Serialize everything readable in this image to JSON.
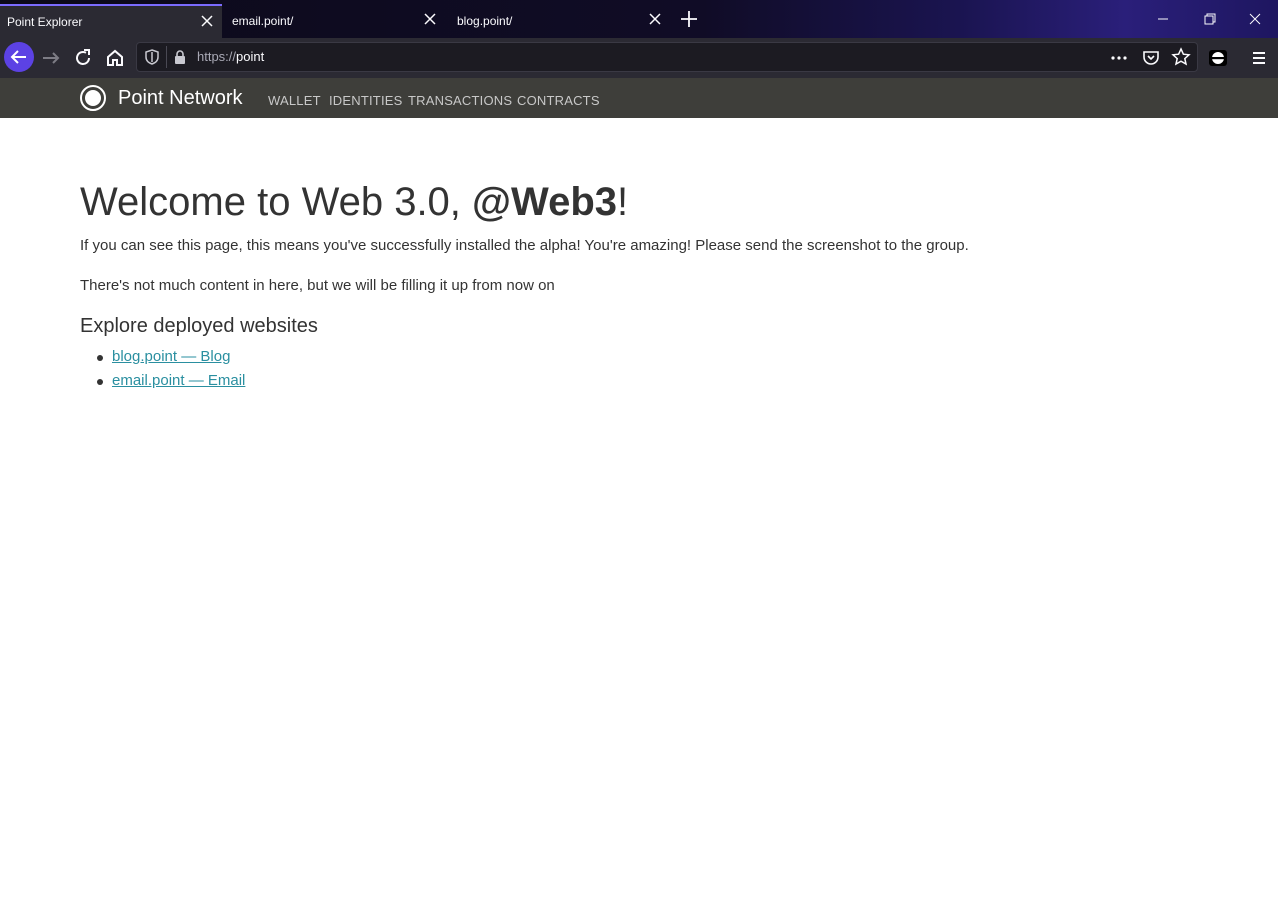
{
  "browser": {
    "tabs": [
      {
        "label": "Point Explorer",
        "active": true
      },
      {
        "label": "email.point/",
        "active": false
      },
      {
        "label": "blog.point/",
        "active": false
      }
    ],
    "url": {
      "scheme": "https://",
      "host": "point"
    },
    "icons": [
      "back-arrow-icon",
      "forward-arrow-icon",
      "reload-icon",
      "home-icon",
      "shield-icon",
      "lock-icon",
      "more-icon",
      "pocket-icon",
      "star-icon",
      "extension-icon",
      "hamburger-menu-icon",
      "new-tab-plus-icon",
      "minimize-icon",
      "restore-icon",
      "close-icon"
    ],
    "accent_color": "#5c42e4"
  },
  "site": {
    "brand": "Point Network",
    "menu": [
      "WALLET",
      "IDENTITIES",
      "TRANSACTIONS",
      "CONTRACTS"
    ]
  },
  "main": {
    "heading_prefix": "Welcome to Web 3.0, ",
    "heading_handle": "@Web3",
    "heading_suffix": "!",
    "paragraph1": "If you can see this page, this means you've successfully installed the alpha! You're amazing! Please send the screenshot to the group.",
    "paragraph2": "There's not much content in here, but we will be filling it up from now on",
    "subheading": "Explore deployed websites",
    "links": [
      {
        "text": "blog.point — Blog"
      },
      {
        "text": "email.point — Email"
      }
    ],
    "link_color": "#2a8fa0"
  }
}
